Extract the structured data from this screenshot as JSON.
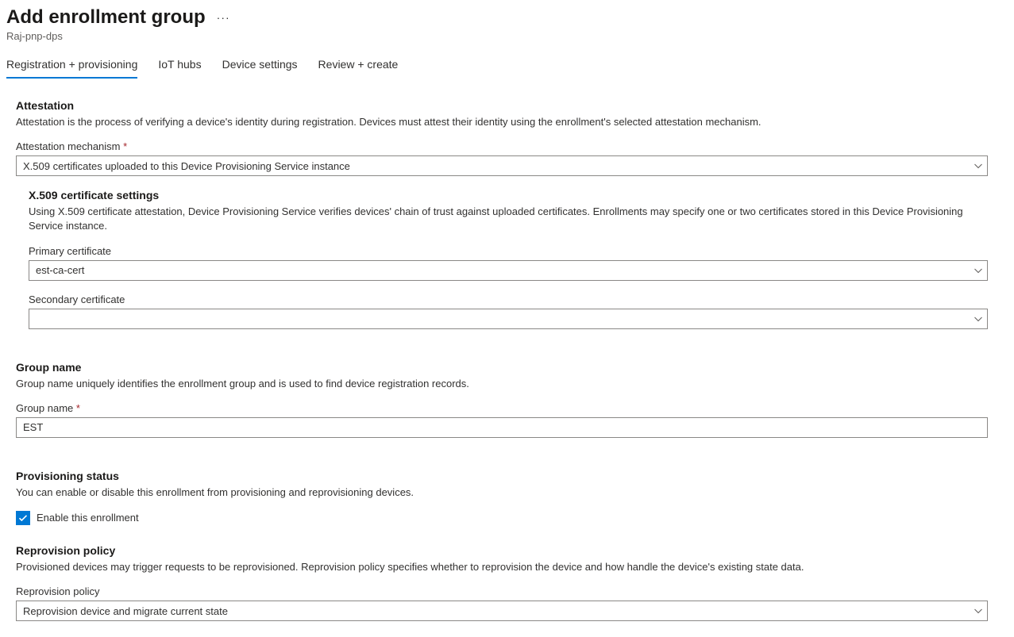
{
  "header": {
    "title": "Add enrollment group",
    "subtitle": "Raj-pnp-dps",
    "more": "···"
  },
  "tabs": [
    {
      "label": "Registration + provisioning",
      "active": true
    },
    {
      "label": "IoT hubs",
      "active": false
    },
    {
      "label": "Device settings",
      "active": false
    },
    {
      "label": "Review + create",
      "active": false
    }
  ],
  "sections": {
    "attestation": {
      "heading": "Attestation",
      "description": "Attestation is the process of verifying a device's identity during registration. Devices must attest their identity using the enrollment's selected attestation mechanism.",
      "mechanism_label": "Attestation mechanism",
      "mechanism_value": "X.509 certificates uploaded to this Device Provisioning Service instance",
      "x509": {
        "heading": "X.509 certificate settings",
        "description": "Using X.509 certificate attestation, Device Provisioning Service verifies devices' chain of trust against uploaded certificates. Enrollments may specify one or two certificates stored in this Device Provisioning Service instance.",
        "primary_label": "Primary certificate",
        "primary_value": "est-ca-cert",
        "secondary_label": "Secondary certificate",
        "secondary_value": ""
      }
    },
    "group_name": {
      "heading": "Group name",
      "description": "Group name uniquely identifies the enrollment group and is used to find device registration records.",
      "label": "Group name",
      "value": "EST"
    },
    "provisioning_status": {
      "heading": "Provisioning status",
      "description": "You can enable or disable this enrollment from provisioning and reprovisioning devices.",
      "checkbox_label": "Enable this enrollment",
      "checked": true
    },
    "reprovision": {
      "heading": "Reprovision policy",
      "description": "Provisioned devices may trigger requests to be reprovisioned. Reprovision policy specifies whether to reprovision the device and how handle the device's existing state data.",
      "label": "Reprovision policy",
      "value": "Reprovision device and migrate current state"
    }
  }
}
